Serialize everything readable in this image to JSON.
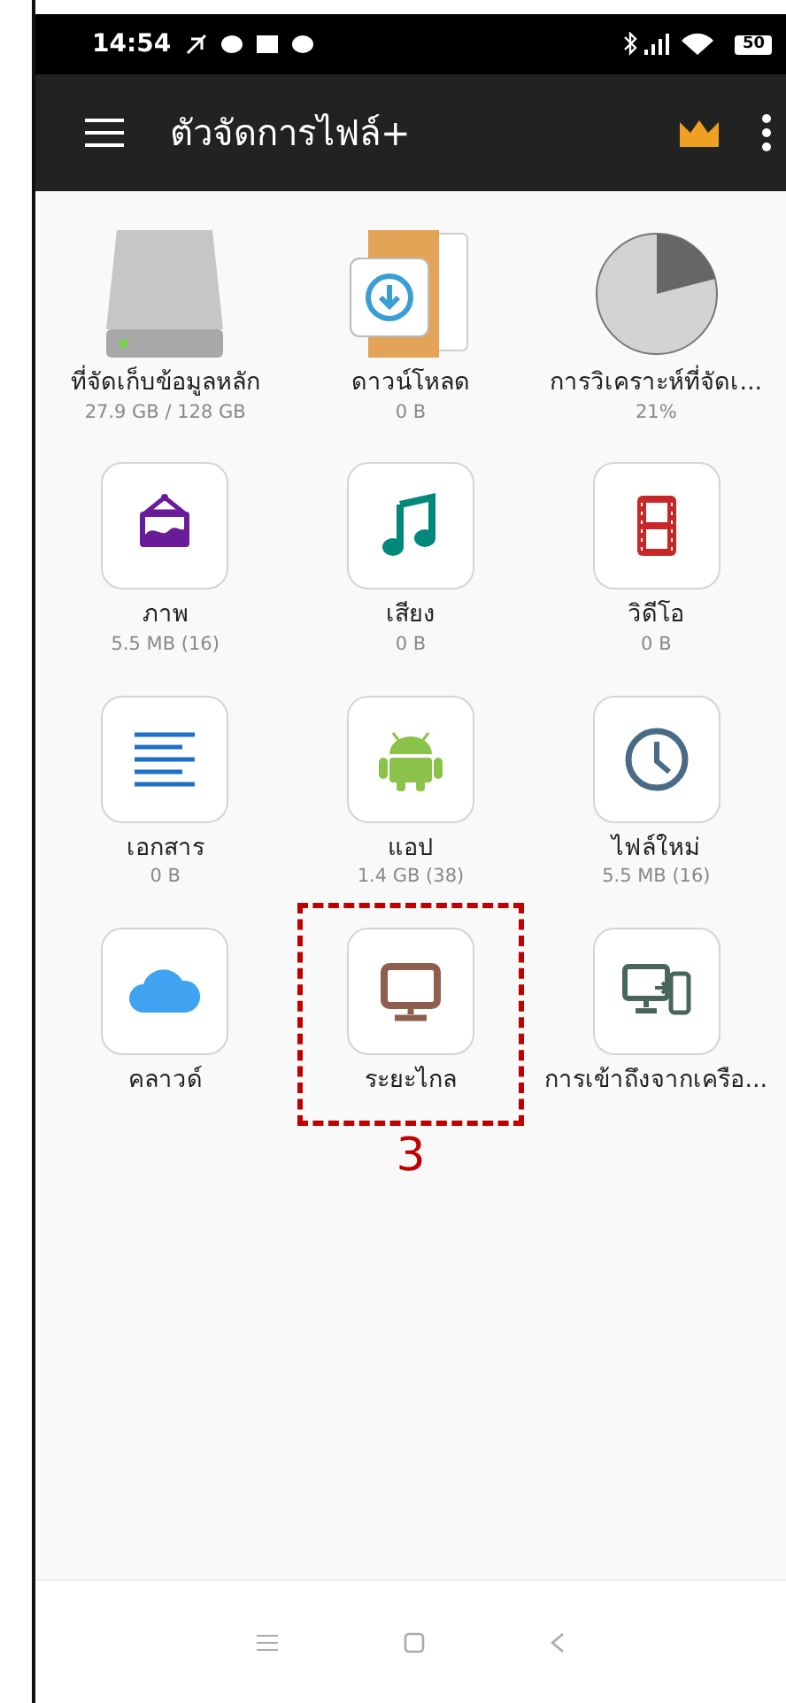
{
  "status_bar": {
    "time": "14:54",
    "battery": "50"
  },
  "app_bar": {
    "title": "ตัวจัดการไฟล์+"
  },
  "items": [
    {
      "label": "ที่จัดเก็บข้อมูลหลัก",
      "detail": "27.9 GB / 128 GB",
      "kind": "drive",
      "highlighted": false
    },
    {
      "label": "ดาวน์โหลด",
      "detail": "0 B",
      "kind": "folder",
      "highlighted": false
    },
    {
      "label": "การวิเคราะห์ที่จัดเ...",
      "detail": "21%",
      "kind": "pie",
      "highlighted": false
    },
    {
      "label": "ภาพ",
      "detail": "5.5 MB (16)",
      "kind": "tile",
      "highlighted": false
    },
    {
      "label": "เสียง",
      "detail": "0 B",
      "kind": "tile",
      "highlighted": false
    },
    {
      "label": "วิดีโอ",
      "detail": "0 B",
      "kind": "tile",
      "highlighted": false
    },
    {
      "label": "เอกสาร",
      "detail": "0 B",
      "kind": "tile",
      "highlighted": false
    },
    {
      "label": "แอป",
      "detail": "1.4 GB (38)",
      "kind": "tile",
      "highlighted": false
    },
    {
      "label": "ไฟล์ใหม่",
      "detail": "5.5 MB (16)",
      "kind": "tile",
      "highlighted": false
    },
    {
      "label": "คลาวด์",
      "kind": "tile",
      "highlighted": false
    },
    {
      "label": "ระยะไกล",
      "kind": "tile",
      "highlighted": true
    },
    {
      "label": "การเข้าถึงจากเครือ...",
      "kind": "tile",
      "highlighted": false
    }
  ],
  "annotation": {
    "label": "3"
  }
}
